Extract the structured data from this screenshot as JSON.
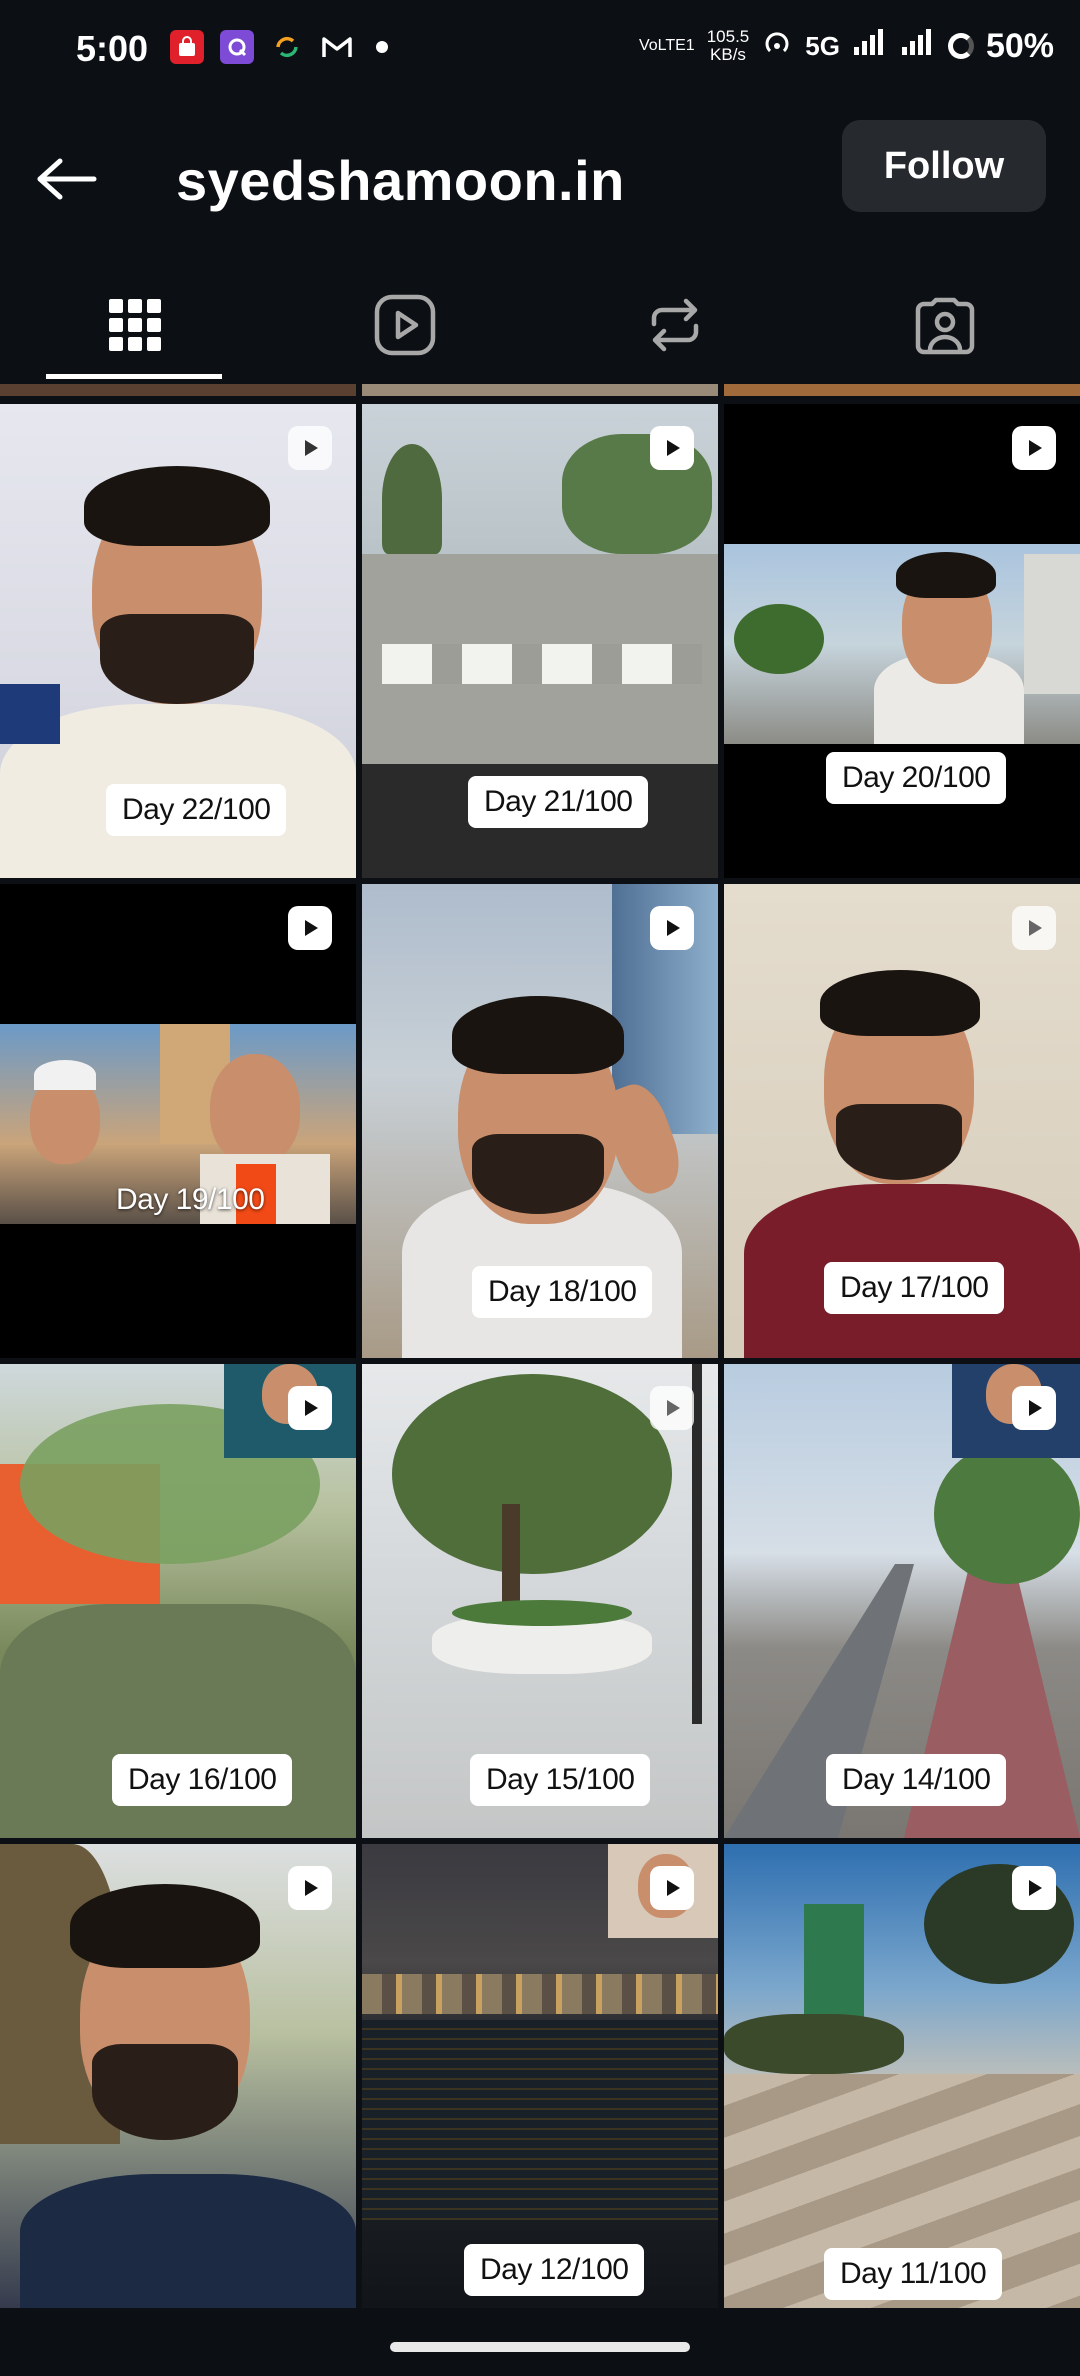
{
  "status_bar": {
    "time": "5:00",
    "network_label": "VoLTE1",
    "speed_value": "105.5",
    "speed_unit": "KB/s",
    "network_type": "5G",
    "battery": "50%"
  },
  "header": {
    "username": "syedshamoon.in",
    "follow_label": "Follow"
  },
  "tabs": [
    {
      "name": "grid",
      "icon": "grid-icon",
      "selected": true
    },
    {
      "name": "reels",
      "icon": "reels-play-icon",
      "selected": false
    },
    {
      "name": "reposts",
      "icon": "repost-icon",
      "selected": false
    },
    {
      "name": "tagged",
      "icon": "tagged-person-icon",
      "selected": false
    }
  ],
  "posts": [
    {
      "label": "Day 22/100"
    },
    {
      "label": "Day 21/100"
    },
    {
      "label": "Day 20/100"
    },
    {
      "label": "Day 19/100"
    },
    {
      "label": "Day 18/100"
    },
    {
      "label": "Day 17/100"
    },
    {
      "label": "Day 16/100"
    },
    {
      "label": "Day 15/100"
    },
    {
      "label": "Day 14/100"
    },
    {
      "label": ""
    },
    {
      "label": "Day 12/100"
    },
    {
      "label": "Day 11/100"
    }
  ]
}
